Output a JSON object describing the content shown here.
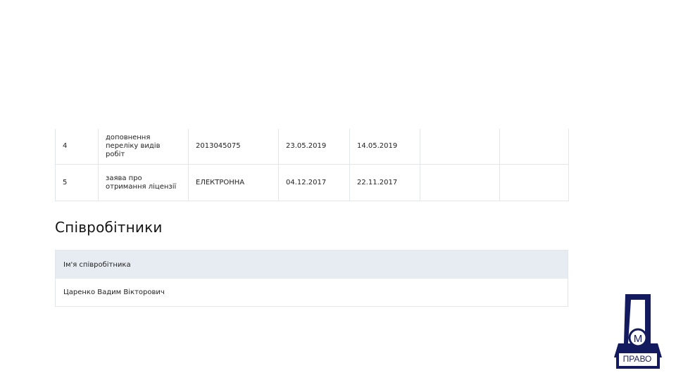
{
  "licenses_table": {
    "rows": [
      {
        "num": "4",
        "type": "доповнення переліку видів робіт",
        "number": "2013045075",
        "date1": "23.05.2019",
        "date2": "14.05.2019",
        "col6": "",
        "col7": ""
      },
      {
        "num": "5",
        "type": "заява про отримання ліцензії",
        "number": "ЕЛЕКТРОННА",
        "date1": "04.12.2017",
        "date2": "22.11.2017",
        "col6": "",
        "col7": ""
      }
    ]
  },
  "employees": {
    "title": "Співробітники",
    "header": "Ім'я співробітника",
    "rows": [
      {
        "name": "Царенко Вадим Вікторович"
      }
    ]
  },
  "logo": {
    "letter": "Д",
    "emblem": "М",
    "caption": "ПРАВО",
    "color": "#141a5e"
  }
}
